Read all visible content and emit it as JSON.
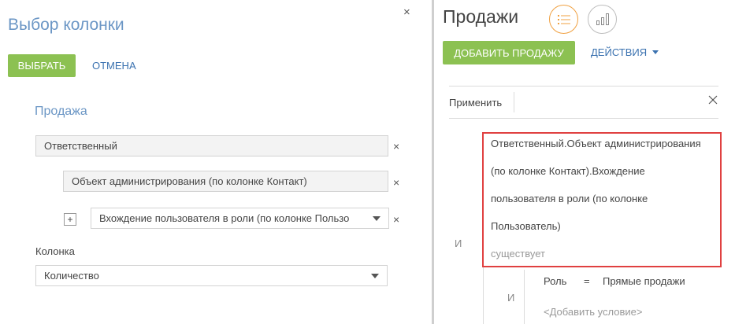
{
  "dialog": {
    "title": "Выбор колонки",
    "close_icon": "×",
    "select_button": "Выбрать",
    "cancel_link": "Отмена",
    "section": "Продажа",
    "path_fields": [
      {
        "value": "Ответственный"
      },
      {
        "value": "Объект администрирования (по колонке Контакт)"
      }
    ],
    "path_select": {
      "value": "Вхождение пользователя в роли (по колонке Пользо"
    },
    "remove_icon": "×",
    "plus_icon": "+",
    "column_label": "Колонка",
    "column_select": {
      "value": "Количество"
    }
  },
  "page": {
    "title": "Продажи",
    "add_button": "Добавить продажу",
    "actions_button": "Действия",
    "view_icons": [
      "list-view-icon",
      "chart-view-icon"
    ],
    "accent_color": "#f0a040",
    "button_color": "#8cc152"
  },
  "filter": {
    "apply_label": "Применить",
    "and_label": "И",
    "condition_lines": [
      "Ответственный.Объект администрирования",
      "(по колонке Контакт).Вхождение",
      "пользователя в роли (по колонке",
      "Пользователь)"
    ],
    "condition_status": "существует",
    "nested_and_label": "И",
    "nested_condition": {
      "column": "Роль",
      "operator": "=",
      "value": "Прямые продажи"
    },
    "add_condition": "<Добавить условие>",
    "highlight_color": "#e04040"
  }
}
